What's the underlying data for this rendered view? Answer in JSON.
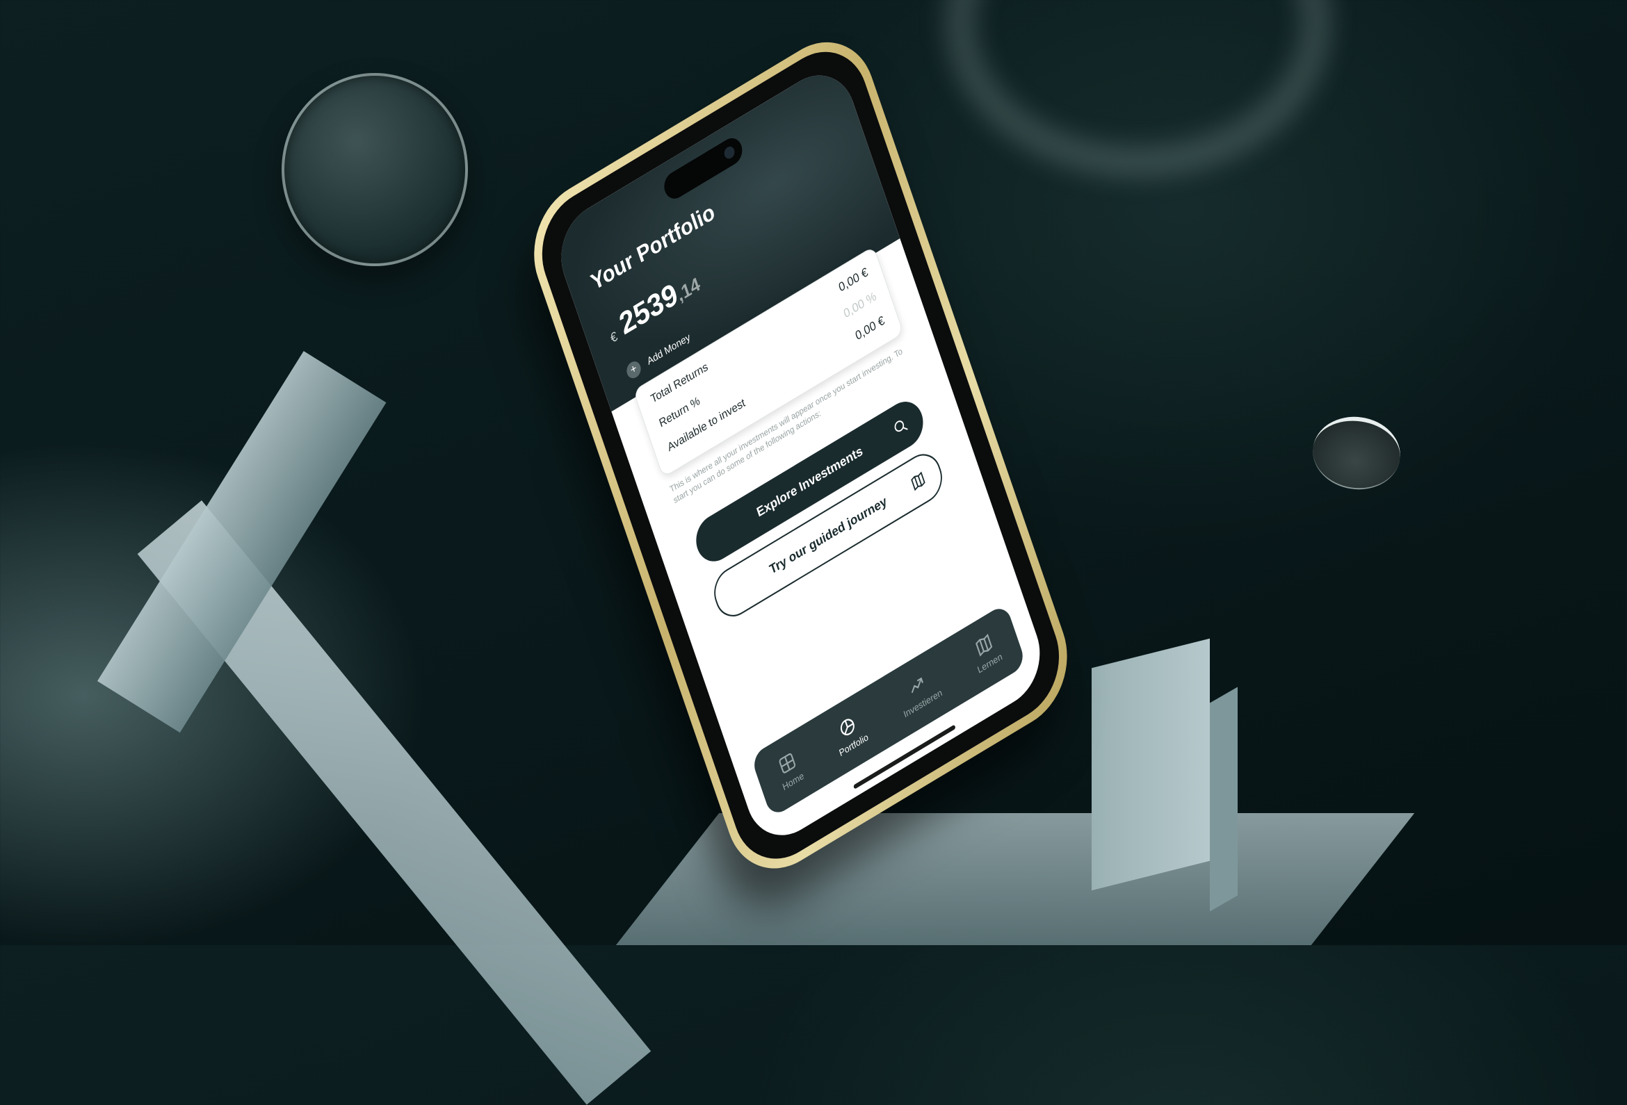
{
  "screen": {
    "title": "Your Portfolio",
    "balance": {
      "currency_symbol": "€",
      "integer_part": "2539",
      "decimal_part": ",14"
    },
    "add_money_label": "Add Money",
    "summary": [
      {
        "label": "Total Returns",
        "value": "0,00 €"
      },
      {
        "label": "Return %",
        "value": "0,00 %"
      },
      {
        "label": "Available to invest",
        "value": "0,00 €"
      }
    ],
    "info_text": "This is where all your investments will appear once you start investing. To start you can do some of the following actions:",
    "buttons": {
      "explore": "Explore Investments",
      "guided": "Try our guided journey"
    },
    "nav": [
      {
        "label": "Home",
        "icon": "home-grid-icon"
      },
      {
        "label": "Portfolio",
        "icon": "portfolio-pie-icon"
      },
      {
        "label": "Investieren",
        "icon": "trend-up-icon"
      },
      {
        "label": "Lernen",
        "icon": "book-open-icon"
      }
    ],
    "active_nav": "Portfolio"
  },
  "colors": {
    "background": "#0a1a1c",
    "header": "#1c2b2e",
    "primary_button": "#1a2b2e",
    "nav_bar": "#2a3a3d",
    "phone_frame": "#d6c78a"
  }
}
